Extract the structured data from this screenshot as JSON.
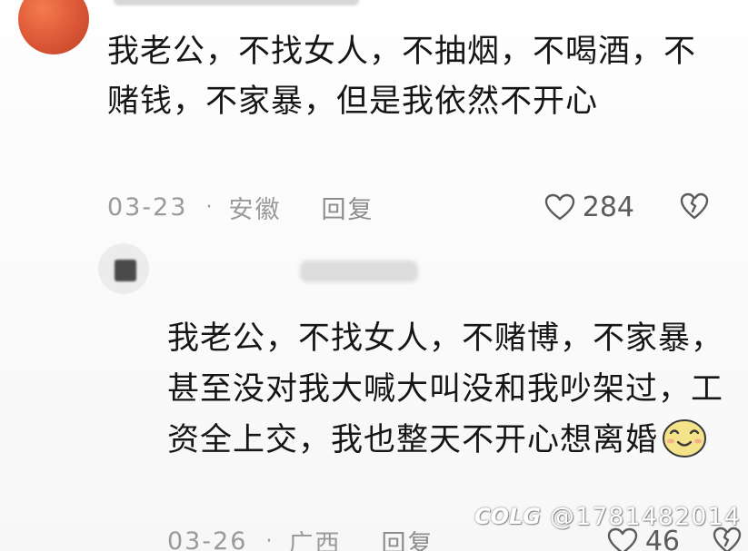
{
  "comments": [
    {
      "text": "我老公，不找女人，不抽烟，不喝酒，不赌钱，不家暴，但是我依然不开心",
      "time": "03-23",
      "location": "安徽",
      "reply_label": "回复",
      "likes": "284"
    },
    {
      "text": "我老公，不找女人，不赌博，不家暴，甚至没对我大喊大叫没和我吵架过，工资全上交，我也整天不开心想离婚",
      "time": "03-26",
      "location": "广西",
      "reply_label": "回复",
      "likes": "46"
    }
  ],
  "watermark": {
    "logo_text": "COLG",
    "handle": "@1781482014"
  },
  "colors": {
    "text": "#161616",
    "meta": "#9a9a9a",
    "avatar_orange": "#db5635",
    "emoji_yellow": "#f5e38a"
  },
  "icons": {
    "like": "heart-outline-icon",
    "dislike": "broken-heart-icon",
    "emoji": "smiling-face-emoji"
  }
}
